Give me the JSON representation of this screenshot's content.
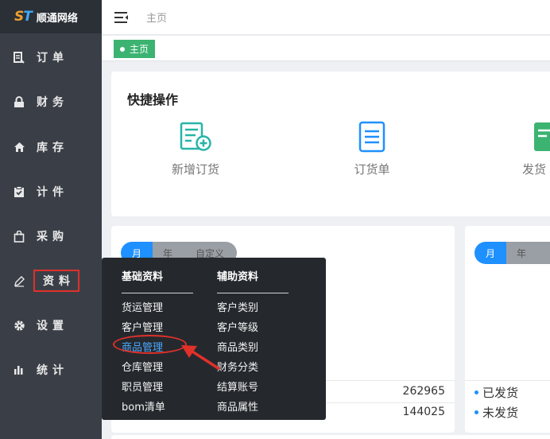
{
  "app": {
    "logo_mark": "ST",
    "title": "顺通网络"
  },
  "sidebar": {
    "items": [
      {
        "icon": "document-icon",
        "label": "订单"
      },
      {
        "icon": "lock-icon",
        "label": "财务"
      },
      {
        "icon": "home-icon",
        "label": "库存"
      },
      {
        "icon": "clipboard-check-icon",
        "label": "计件"
      },
      {
        "icon": "shopping-bag-icon",
        "label": "采购"
      },
      {
        "icon": "pencil-icon",
        "label": "资料"
      },
      {
        "icon": "gear-icon",
        "label": "设置"
      },
      {
        "icon": "bar-chart-icon",
        "label": "统计"
      }
    ]
  },
  "topbar": {
    "breadcrumb": "主页"
  },
  "tabs": [
    {
      "label": "主页"
    }
  ],
  "quick": {
    "title": "快捷操作",
    "actions": [
      {
        "icon": "add-order-icon",
        "label": "新增订货"
      },
      {
        "icon": "order-list-icon",
        "label": "订货单"
      },
      {
        "icon": "shipping-icon",
        "label": "发货"
      }
    ]
  },
  "stats": {
    "segments": [
      "月",
      "年",
      "自定义"
    ],
    "values": [
      "262965",
      "144025"
    ],
    "legend": [
      "已发货",
      "未发货"
    ]
  },
  "flyout": {
    "col1_title": "基础资料",
    "col1": [
      "货运管理",
      "客户管理",
      "商品管理",
      "仓库管理",
      "职员管理",
      "bom清单"
    ],
    "col2_title": "辅助资料",
    "col2": [
      "客户类别",
      "客户等级",
      "商品类别",
      "财务分类",
      "结算账号",
      "商品属性"
    ]
  },
  "colors": {
    "sidebar": "#3a3f47",
    "accent": "#1e90ff",
    "tab": "#3cb371",
    "quick_icon": "#27b5a8",
    "annotation": "#e0302a"
  }
}
